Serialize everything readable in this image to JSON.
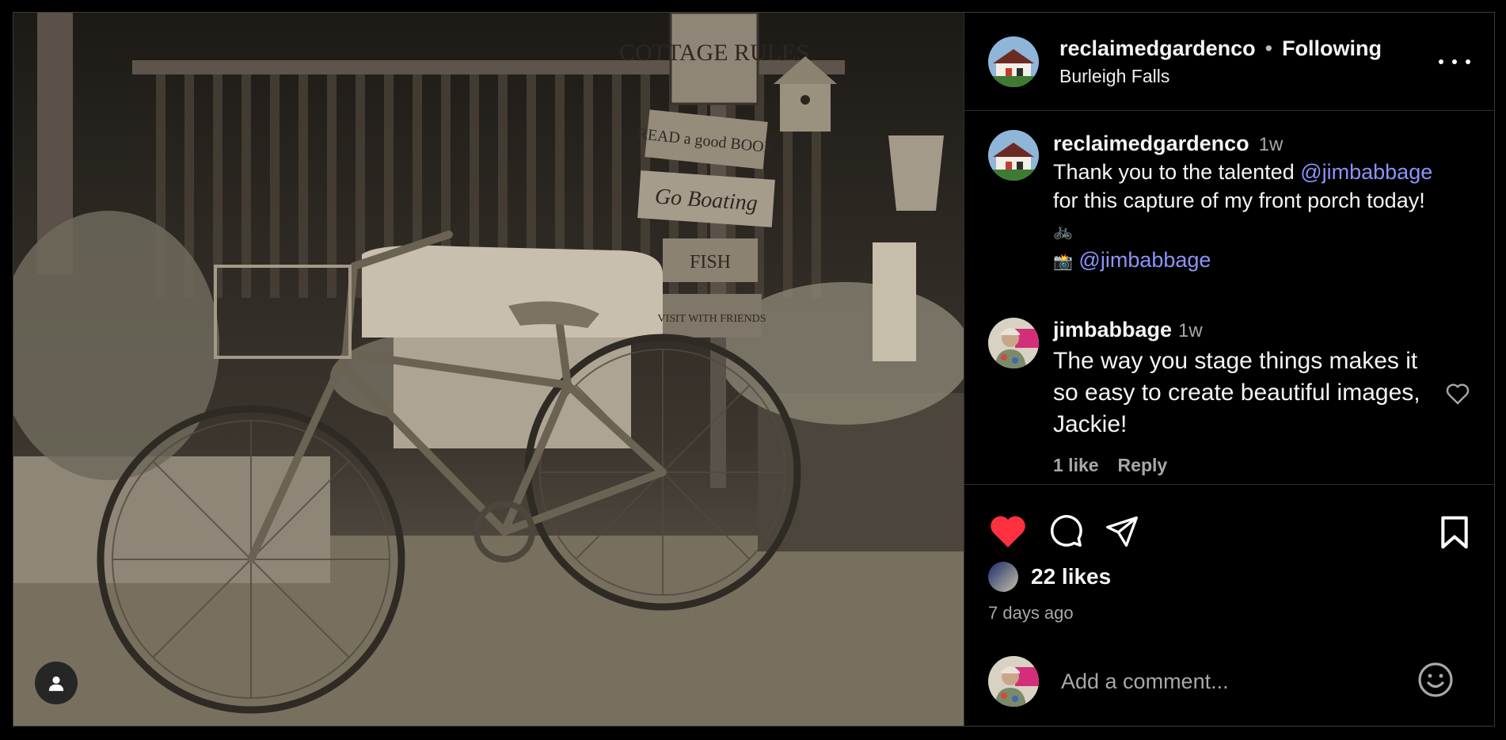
{
  "post": {
    "image_alt": "Sepia photo of a vintage bicycle leaning against a bench on a porch with wooden signs",
    "signs": [
      "COTTAGE RULES",
      "READ a good BOOK",
      "Go Boating",
      "FISH",
      "VISIT WITH FRIENDS"
    ],
    "user_tag_icon": "person-icon"
  },
  "header": {
    "username": "reclaimedgardenco",
    "separator": "•",
    "follow_status": "Following",
    "location": "Burleigh Falls"
  },
  "caption": {
    "username": "reclaimedgardenco",
    "time": "1w",
    "text_before": "Thank you to the talented ",
    "mention1": "@jimbabbage",
    "text_after": "for this capture of my front porch today!",
    "emoji_line": "🚲",
    "camera_emoji": "📸",
    "mention2": "@jimbabbage"
  },
  "comment": {
    "username": "jimbabbage",
    "time": "1w",
    "text": "The way you stage things makes it so easy to create beautiful images, Jackie!",
    "likes": "1 like",
    "reply": "Reply"
  },
  "engagement": {
    "likes": "22 likes",
    "time_ago": "7 days ago",
    "liked": true
  },
  "compose": {
    "placeholder": "Add a comment..."
  },
  "colors": {
    "background": "#000000",
    "mention": "#8b93f8",
    "heart": "#ff3040",
    "muted": "#a8a8a8"
  }
}
